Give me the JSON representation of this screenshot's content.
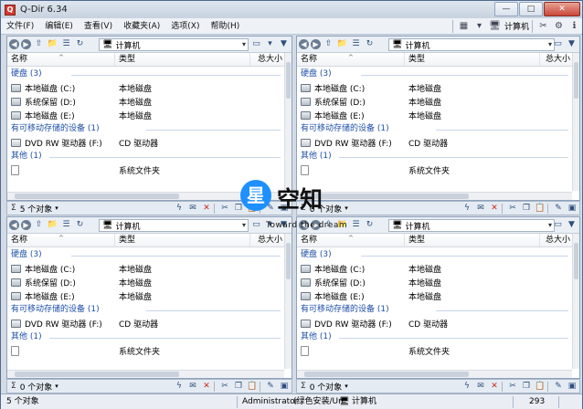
{
  "app": {
    "title": "Q-Dir 6.34",
    "icon_text": "Q"
  },
  "window_buttons": {
    "minimize": "—",
    "maximize": "□",
    "close": "✕"
  },
  "menu": [
    "文件(F)",
    "编辑(E)",
    "查看(V)",
    "收藏夹(A)",
    "选项(X)",
    "帮助(H)"
  ],
  "toolbar": {
    "computer_label": "计算机"
  },
  "pane_header": {
    "name": "名称",
    "type": "类型",
    "size": "总大小"
  },
  "panes": [
    {
      "id": "top-left",
      "address": "计算机",
      "groups": {
        "hard_disk": "硬盘 (3)",
        "removable": "有可移动存储的设备 (1)",
        "other": "其他 (1)"
      },
      "rows": {
        "disk_c": {
          "name": "本地磁盘 (C:)",
          "type": "本地磁盘"
        },
        "disk_d": {
          "name": "系统保留 (D:)",
          "type": "本地磁盘"
        },
        "disk_e": {
          "name": "本地磁盘 (E:)",
          "type": "本地磁盘"
        },
        "dvd": {
          "name": "DVD RW 驱动器 (F:)",
          "type": "CD 驱动器"
        },
        "sys": {
          "name": "",
          "type": "系统文件夹"
        }
      },
      "status_count": "5 个对象"
    },
    {
      "id": "top-right",
      "address": "计算机",
      "groups": {
        "hard_disk": "硬盘 (3)",
        "removable": "有可移动存储的设备 (1)",
        "other": "其他 (1)"
      },
      "rows": {
        "disk_c": {
          "name": "本地磁盘 (C:)",
          "type": "本地磁盘"
        },
        "disk_d": {
          "name": "系统保留 (D:)",
          "type": "本地磁盘"
        },
        "disk_e": {
          "name": "本地磁盘 (E:)",
          "type": "本地磁盘"
        },
        "dvd": {
          "name": "DVD RW 驱动器 (F:)",
          "type": "CD 驱动器"
        },
        "sys": {
          "name": "",
          "type": "系统文件夹"
        }
      },
      "status_count": "0 个对象"
    },
    {
      "id": "bottom-left",
      "address": "计算机",
      "groups": {
        "hard_disk": "硬盘 (3)",
        "removable": "有可移动存储的设备 (1)",
        "other": "其他 (1)"
      },
      "rows": {
        "disk_c": {
          "name": "本地磁盘 (C:)",
          "type": "本地磁盘"
        },
        "disk_d": {
          "name": "系统保留 (D:)",
          "type": "本地磁盘"
        },
        "disk_e": {
          "name": "本地磁盘 (E:)",
          "type": "本地磁盘"
        },
        "dvd": {
          "name": "DVD RW 驱动器 (F:)",
          "type": "CD 驱动器"
        },
        "sys": {
          "name": "",
          "type": "系统文件夹"
        }
      },
      "status_count": "0 个对象"
    },
    {
      "id": "bottom-right",
      "address": "计算机",
      "groups": {
        "hard_disk": "硬盘 (3)",
        "removable": "有可移动存储的设备 (1)",
        "other": "其他 (1)"
      },
      "rows": {
        "disk_c": {
          "name": "本地磁盘 (C:)",
          "type": "本地磁盘"
        },
        "disk_d": {
          "name": "系统保留 (D:)",
          "type": "本地磁盘"
        },
        "disk_e": {
          "name": "本地磁盘 (E:)",
          "type": "本地磁盘"
        },
        "dvd": {
          "name": "DVD RW 驱动器 (F:)",
          "type": "CD 驱动器"
        },
        "sys": {
          "name": "",
          "type": "系统文件夹"
        }
      },
      "status_count": "0 个对象"
    }
  ],
  "status_sigma": "Σ",
  "global_status": {
    "count": "5 个对象",
    "user": "Administrator",
    "mode": "(绿色安装/Un",
    "location": "计算机",
    "number": "293"
  },
  "watermark": {
    "star": "星",
    "brand": "空知",
    "tagline": "Toward the dream"
  },
  "colors": {
    "group_text": "#1e4fa8",
    "accent_red": "#d0271d",
    "title_bar": "#c7d2df"
  }
}
